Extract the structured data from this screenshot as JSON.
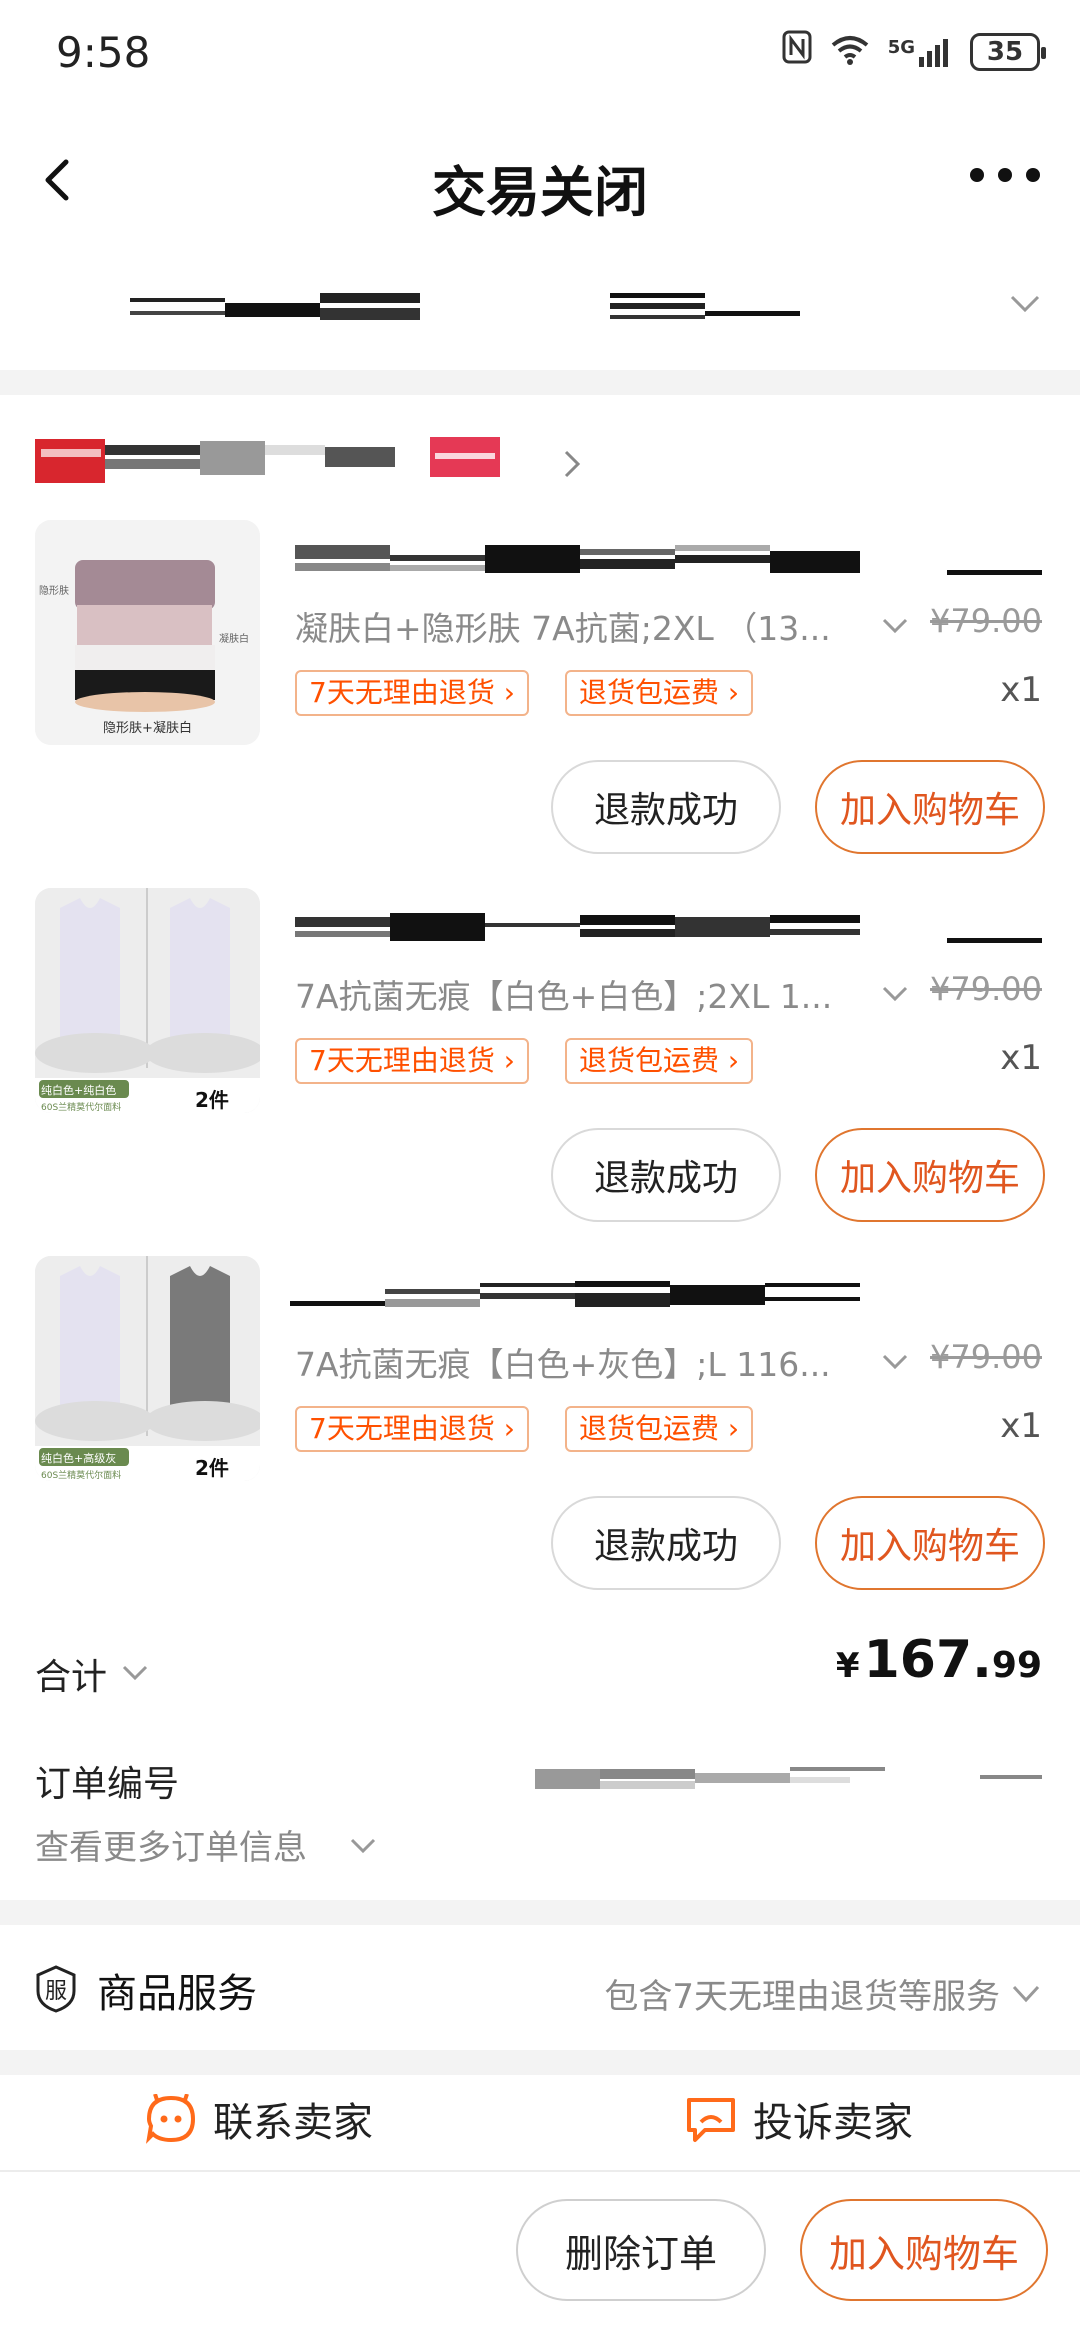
{
  "status_bar": {
    "time": "9:58",
    "network": "5G",
    "battery": "35"
  },
  "navbar": {
    "title": "交易关闭"
  },
  "colors": {
    "accent": "#ff5000",
    "button_orange": "#e0561f",
    "tag_border": "#f3b38a",
    "muted_text": "#8a8a8a"
  },
  "icons": [
    "back-arrow-icon",
    "more-dots-icon",
    "chevron-down-icon",
    "chevron-right-icon",
    "shield-service-icon",
    "chat-face-icon",
    "complaint-icon"
  ],
  "products": [
    {
      "sku": "凝肤白+隐形肤 7A抗菌;2XL （13...",
      "original_price": "¥79.00",
      "tags": [
        "7天无理由退货 ›",
        "退货包运费 ›"
      ],
      "quantity": "x1",
      "status_button": "退款成功",
      "cart_button": "加入购物车"
    },
    {
      "sku": "7A抗菌无痕【白色+白色】;2XL 1...",
      "original_price": "¥79.00",
      "tags": [
        "7天无理由退货 ›",
        "退货包运费 ›"
      ],
      "quantity": "x1",
      "status_button": "退款成功",
      "cart_button": "加入购物车"
    },
    {
      "sku": "7A抗菌无痕【白色+灰色】;L 116...",
      "original_price": "¥79.00",
      "tags": [
        "7天无理由退货 ›",
        "退货包运费 ›"
      ],
      "quantity": "x1",
      "status_button": "退款成功",
      "cart_button": "加入购物车"
    }
  ],
  "thumbnails": [
    {
      "caption": "隐形肤+凝肤白",
      "side_label_left": "隐形肤",
      "side_label_right": "凝肤白"
    },
    {
      "caption": "纯白色+纯白色",
      "count": "2件",
      "subcaption": "60S兰精莫代尔面料"
    },
    {
      "caption": "纯白色+高级灰",
      "count": "2件",
      "subcaption": "60S兰精莫代尔面料"
    }
  ],
  "total": {
    "label": "合计",
    "currency": "¥",
    "integer": "167.",
    "decimal": "99"
  },
  "order": {
    "number_label": "订单编号",
    "more_info": "查看更多订单信息"
  },
  "service": {
    "label": "商品服务",
    "desc": "包含7天无理由退货等服务",
    "icon_char": "服"
  },
  "contact": {
    "seller": "联系卖家",
    "complain": "投诉卖家"
  },
  "bottom_bar": {
    "delete": "删除订单",
    "add_cart": "加入购物车"
  }
}
